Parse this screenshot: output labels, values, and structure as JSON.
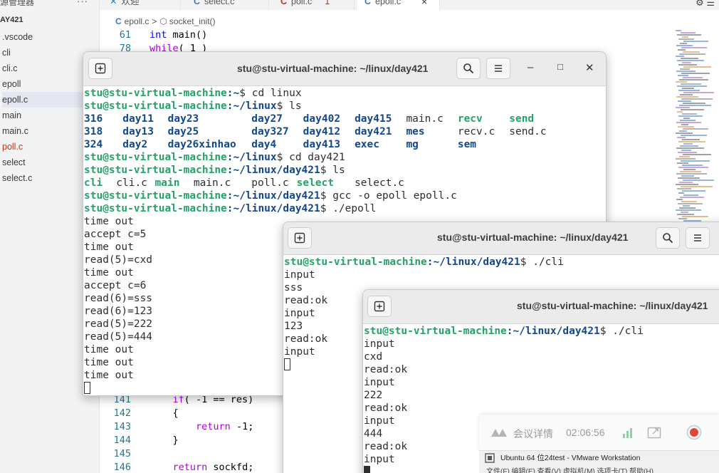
{
  "vscode": {
    "explorer_title": "源管理器",
    "more": "···",
    "folder": "AY421",
    "files": [
      {
        "label": ".vscode",
        "color": "normal"
      },
      {
        "label": "cli",
        "color": "normal"
      },
      {
        "label": "cli.c",
        "color": "normal"
      },
      {
        "label": "epoll",
        "color": "normal"
      },
      {
        "label": "epoll.c",
        "color": "active"
      },
      {
        "label": "main",
        "color": "normal"
      },
      {
        "label": "main.c",
        "color": "normal"
      },
      {
        "label": "poll.c",
        "color": "red"
      },
      {
        "label": "select",
        "color": "normal"
      },
      {
        "label": "select.c",
        "color": "normal"
      }
    ],
    "tabs": {
      "welcome": "欢迎",
      "select": "select.c",
      "poll": "poll.c",
      "poll_badge": "1",
      "epoll": "epoll.c",
      "close": "×"
    },
    "tab_c_glyph": "C",
    "top_icons": "⚙ ☰",
    "breadcrumb": {
      "file": "epoll.c",
      "separator": ">",
      "symbol_icon": "⬡",
      "symbol": "socket_init()"
    },
    "code_top": [
      {
        "ln": "61",
        "kw": "int",
        "rest": " main()"
      },
      {
        "ln": "78",
        "kw": "while",
        "rest": "( 1 )"
      }
    ],
    "code_bottom": [
      {
        "ln": "141",
        "pre": "    ",
        "kw": "if",
        "rest": "( -1 == res)"
      },
      {
        "ln": "142",
        "pre": "    ",
        "kw": "",
        "rest": "{"
      },
      {
        "ln": "143",
        "pre": "        ",
        "kw": "return",
        "rest": " -1;"
      },
      {
        "ln": "144",
        "pre": "    ",
        "kw": "",
        "rest": "}"
      },
      {
        "ln": "145",
        "pre": "",
        "kw": "",
        "rest": ""
      },
      {
        "ln": "146",
        "pre": "    ",
        "kw": "return",
        "rest": " sockfd;"
      }
    ]
  },
  "terminals": {
    "main": {
      "title": "stu@stu-virtual-machine: ~/linux/day421",
      "controls": {
        "minimize": "–",
        "maximize": "□",
        "close": "✕"
      },
      "lines": [
        {
          "prompt_user": "stu@stu-virtual-machine",
          "prompt_path": ":~",
          "cmd": "$ cd linux"
        },
        {
          "prompt_user": "stu@stu-virtual-machine",
          "prompt_path": ":~/linux",
          "cmd": "$ ls"
        },
        {
          "ls": [
            [
              "316",
              "dir"
            ],
            [
              "day11",
              "dir"
            ],
            [
              "day23",
              "dir"
            ],
            [
              "day27",
              "dir"
            ],
            [
              "day402",
              "dir"
            ],
            [
              "day415",
              "dir"
            ],
            [
              "main.c",
              "file"
            ],
            [
              "recv",
              "exe"
            ],
            [
              "send",
              "exe"
            ]
          ]
        },
        {
          "ls": [
            [
              "318",
              "dir"
            ],
            [
              "day13",
              "dir"
            ],
            [
              "day25",
              "dir"
            ],
            [
              "day327",
              "dir"
            ],
            [
              "day412",
              "dir"
            ],
            [
              "day421",
              "dir"
            ],
            [
              "mes",
              "dir"
            ],
            [
              "recv.c",
              "file"
            ],
            [
              "send.c",
              "file"
            ]
          ]
        },
        {
          "ls": [
            [
              "324",
              "dir"
            ],
            [
              "day2",
              "dir"
            ],
            [
              "day26xinhao",
              "dir"
            ],
            [
              "day4",
              "dir"
            ],
            [
              "day413",
              "dir"
            ],
            [
              "exec",
              "dir"
            ],
            [
              "mg",
              "dir"
            ],
            [
              "sem",
              "dir"
            ]
          ]
        },
        {
          "prompt_user": "stu@stu-virtual-machine",
          "prompt_path": ":~/linux",
          "cmd": "$ cd day421"
        },
        {
          "prompt_user": "stu@stu-virtual-machine",
          "prompt_path": ":~/linux/day421",
          "cmd": "$ ls"
        },
        {
          "ls": [
            [
              "cli",
              "exe"
            ],
            [
              "cli.c",
              "file"
            ],
            [
              "main",
              "exe"
            ],
            [
              "main.c",
              "file"
            ],
            [
              "poll.c",
              "file"
            ],
            [
              "select",
              "exe"
            ],
            [
              "select.c",
              "file"
            ]
          ]
        },
        {
          "prompt_user": "stu@stu-virtual-machine",
          "prompt_path": ":~/linux/day421",
          "cmd": "$ gcc -o epoll epoll.c"
        },
        {
          "prompt_user": "stu@stu-virtual-machine",
          "prompt_path": ":~/linux/day421",
          "cmd": "$ ./epoll"
        },
        {
          "text": "time out"
        },
        {
          "text": "accept c=5"
        },
        {
          "text": "time out"
        },
        {
          "text": "read(5)=cxd"
        },
        {
          "text": "time out"
        },
        {
          "text": "accept c=6"
        },
        {
          "text": "read(6)=sss"
        },
        {
          "text": "read(6)=123"
        },
        {
          "text": "read(5)=222"
        },
        {
          "text": "read(5)=444"
        },
        {
          "text": "time out"
        },
        {
          "text": "time out"
        },
        {
          "text": "time out"
        },
        {
          "cursor": "hollow"
        }
      ]
    },
    "client1": {
      "title": "stu@stu-virtual-machine: ~/linux/day421",
      "lines": [
        {
          "prompt_user": "stu@stu-virtual-machine",
          "prompt_path": ":~/linux/day421",
          "cmd": "$ ./cli"
        },
        {
          "text": "input"
        },
        {
          "text": "sss"
        },
        {
          "text": "read:ok"
        },
        {
          "text": "input"
        },
        {
          "text": "123"
        },
        {
          "text": "read:ok"
        },
        {
          "text": "input"
        },
        {
          "cursor": "hollow"
        }
      ]
    },
    "client2": {
      "title": "stu@stu-virtual-machine: ~/linux/day421",
      "lines": [
        {
          "prompt_user": "stu@stu-virtual-machine",
          "prompt_path": ":~/linux/day421",
          "cmd": "$ ./cli"
        },
        {
          "text": "input"
        },
        {
          "text": "cxd"
        },
        {
          "text": "read:ok"
        },
        {
          "text": "input"
        },
        {
          "text": "222"
        },
        {
          "text": "read:ok"
        },
        {
          "text": "input"
        },
        {
          "text": "444"
        },
        {
          "text": "read:ok"
        },
        {
          "text": "input"
        },
        {
          "cursor": "solid"
        }
      ]
    }
  },
  "meeting": {
    "label": "会议详情",
    "time": "02:06:56"
  },
  "vmware": {
    "title": "Ubuntu 64 位24test - VMware Workstation",
    "menu": "文件(F)  编辑(E)  查看(V)  虚拟机(M)  选项卡(T)  帮助(H)"
  },
  "colors": {
    "prompt_user": "#26a269",
    "prompt_path": "#12488b",
    "terminal_header": "#ebebeb",
    "vscode_line_number": "#237893",
    "vscode_keyword": "#0000ff",
    "record_red": "#e0443e"
  }
}
